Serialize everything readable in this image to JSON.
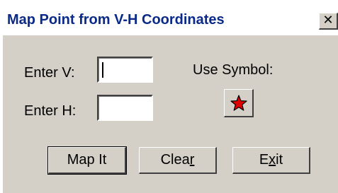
{
  "window": {
    "title": "Map Point from V-H Coordinates",
    "close_glyph": "✕"
  },
  "form": {
    "v_label": "Enter V:",
    "v_value": "",
    "h_label": "Enter H:",
    "h_value": "",
    "symbol_label": "Use Symbol:",
    "symbol_icon": "red-star-icon",
    "symbol_color": "#e00000"
  },
  "buttons": {
    "map_it": "Map It",
    "clear_before": "Clea",
    "clear_underlined": "r",
    "exit_before": "E",
    "exit_underlined": "x",
    "exit_after": "it"
  },
  "colors": {
    "dialog_bg": "#d4d0c8",
    "title_text": "#0a2a8a"
  }
}
